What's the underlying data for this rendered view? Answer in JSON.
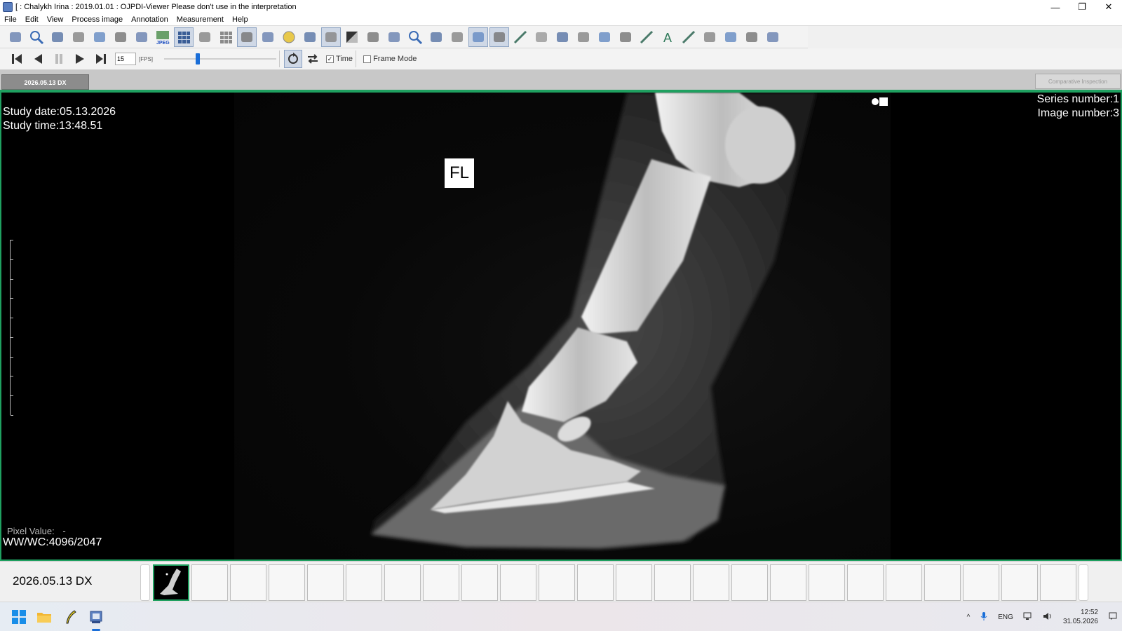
{
  "window": {
    "title": "[ : Chalykh Irina : 2019.01.01 : OJPDI-Viewer  Please don't use in the interpretation",
    "controls": {
      "minimize": "—",
      "maximize": "❐",
      "close": "✕"
    }
  },
  "menu": [
    "File",
    "Edit",
    "View",
    "Process image",
    "Annotation",
    "Measurement",
    "Help"
  ],
  "toolbar": {
    "icons": [
      "database-icon",
      "find-icon",
      "user-icon",
      "users-icon",
      "export-icon",
      "import-icon",
      "copy-icon",
      "jpeg-icon",
      "layout-icon",
      "series-icon",
      "grid-icon",
      "patient-icon",
      "print-icon",
      "info-icon",
      "edit-icon",
      "dicom-icon",
      "window-level-icon",
      "roi-icon",
      "pan-icon",
      "zoom-icon",
      "rotate-icon",
      "invert-icon",
      "filter-icon",
      "sharpen-icon",
      "ruler-icon",
      "pixel-icon",
      "head-icon",
      "brain-icon",
      "skull-icon",
      "heart-icon",
      "line-icon",
      "text-icon",
      "pen-icon",
      "angle-icon",
      "rect-icon",
      "ellipse-icon",
      "polygon-icon"
    ],
    "jpeg_label": "JPEG"
  },
  "playback": {
    "fps_value": "15",
    "fps_label": "[FPS]",
    "time_label": "Time",
    "time_checked": "✓",
    "frame_mode_label": "Frame Mode",
    "slider_fraction": 0.29
  },
  "tabs": {
    "study_tab": "2026.05.13 DX",
    "comparative_button": "Comparative Inspection"
  },
  "viewer": {
    "study_date": "Study date:05.13.2026",
    "study_time": "Study time:13:48.51",
    "series_number": "Series number:1",
    "image_number": "Image number:3",
    "marker": "FL",
    "pixel_value_label": "Pixel Value:",
    "pixel_value": "-",
    "ww_wc": "WW/WC:4096/2047"
  },
  "strip": {
    "label": "2026.05.13 DX"
  },
  "taskbar": {
    "language": "ENG",
    "time": "12:52",
    "date": "31.05.2026"
  },
  "colors": {
    "accent_green": "#1fa060",
    "accent_blue": "#1a6ed8"
  }
}
